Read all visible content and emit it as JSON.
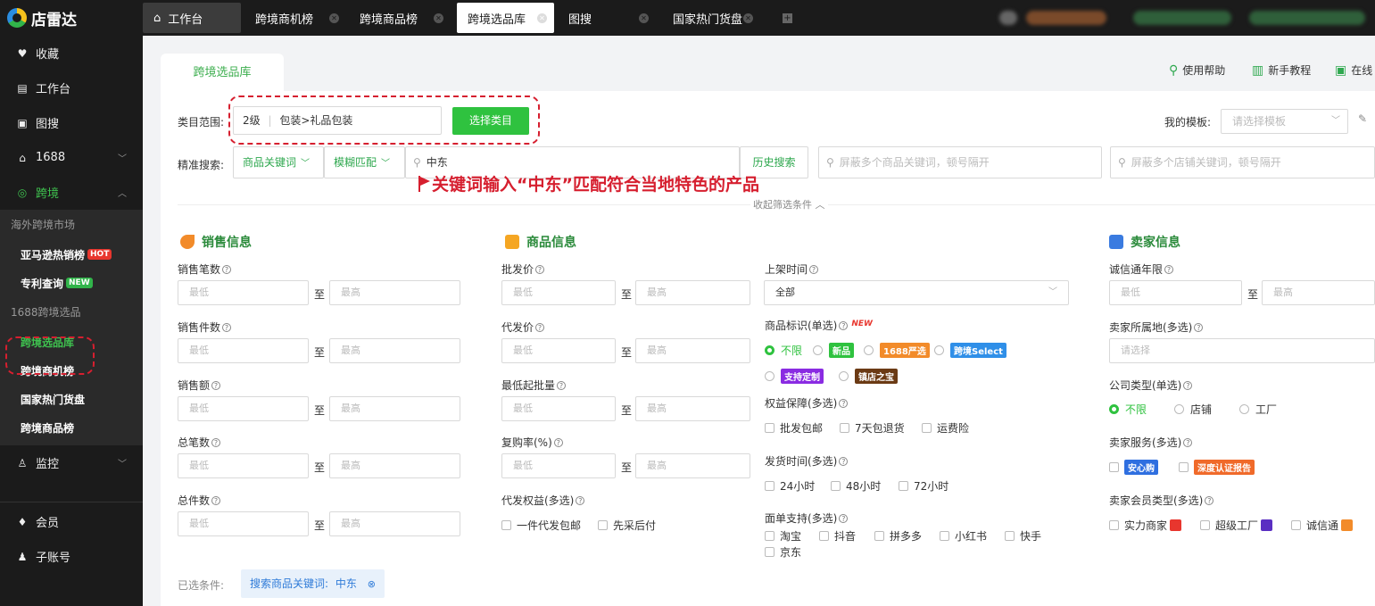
{
  "app": {
    "name": "店雷达"
  },
  "sidebar": {
    "top_items": [
      {
        "label": "收藏",
        "icon": "heart-icon"
      },
      {
        "label": "工作台",
        "icon": "desk-icon"
      },
      {
        "label": "图搜",
        "icon": "image-icon"
      },
      {
        "label": "1688",
        "icon": "shop-icon"
      },
      {
        "label": "跨境",
        "icon": "globe-icon"
      }
    ],
    "group1": "海外跨境市场",
    "sub1": [
      {
        "label": "亚马逊热销榜",
        "badge": "HOT"
      },
      {
        "label": "专利查询",
        "badge": "NEW"
      }
    ],
    "group2": "1688跨境选品",
    "sub2": [
      {
        "label": "跨境选品库"
      },
      {
        "label": "跨境商机榜"
      },
      {
        "label": "国家热门货盘"
      },
      {
        "label": "跨境商品榜"
      }
    ],
    "monitor": "监控",
    "bottom_items": [
      {
        "label": "会员"
      },
      {
        "label": "子账号"
      }
    ]
  },
  "tabs": [
    {
      "label": "工作台"
    },
    {
      "label": "跨境商机榜"
    },
    {
      "label": "跨境商品榜"
    },
    {
      "label": "跨境选品库"
    },
    {
      "label": "图搜"
    },
    {
      "label": "国家热门货盘"
    }
  ],
  "page": {
    "tab_title": "跨境选品库",
    "help": [
      "使用帮助",
      "新手教程",
      "在线"
    ],
    "category_label": "类目范围:",
    "category_level": "2级",
    "category_path": "包装>礼品包装",
    "choose_category": "选择类目",
    "template_label": "我的模板:",
    "template_placeholder": "请选择模板",
    "precise_label": "精准搜索:",
    "keyword_type": "商品关键词",
    "match_type": "模糊匹配",
    "keyword_value": "中东",
    "history": "历史搜索",
    "block_goods_placeholder": "屏蔽多个商品关键词，顿号隔开",
    "block_shop_placeholder": "屏蔽多个店铺关键词，顿号隔开",
    "collapse": "收起筛选条件",
    "annotation": "关键词输入“中东”匹配符合当地特色的产品"
  },
  "sales": {
    "title": "销售信息",
    "fields": [
      "销售笔数",
      "销售件数",
      "销售额",
      "总笔数",
      "总件数"
    ],
    "min": "最低",
    "max": "最高",
    "to": "至"
  },
  "goods": {
    "title": "商品信息",
    "fields": [
      "批发价",
      "代发价",
      "最低起批量",
      "复购率(%)"
    ],
    "daifa_title": "代发权益(多选)",
    "daifa_options": [
      "一件代发包邮",
      "先采后付"
    ],
    "shelf_time_label": "上架时间",
    "shelf_time_value": "全部",
    "mark_label": "商品标识(单选)",
    "mark_new": "NEW",
    "mark_options": [
      "不限",
      "新品",
      "1688严选",
      "跨境Select",
      "支持定制",
      "镇店之宝"
    ],
    "rights_label": "权益保障(多选)",
    "rights_options": [
      "批发包邮",
      "7天包退货",
      "运费险"
    ],
    "ship_label": "发货时间(多选)",
    "ship_options": [
      "24小时",
      "48小时",
      "72小时"
    ],
    "waybill_label": "面单支持(多选)",
    "waybill_options": [
      "淘宝",
      "抖音",
      "拼多多",
      "小红书",
      "快手",
      "京东"
    ]
  },
  "seller": {
    "title": "卖家信息",
    "years_label": "诚信通年限",
    "location_label": "卖家所属地(多选)",
    "location_placeholder": "请选择",
    "company_label": "公司类型(单选)",
    "company_options": [
      "不限",
      "店铺",
      "工厂"
    ],
    "service_label": "卖家服务(多选)",
    "service_options": [
      "安心购",
      "深度认证报告"
    ],
    "member_label": "卖家会员类型(多选)",
    "member_options": [
      "实力商家",
      "超级工厂",
      "诚信通"
    ]
  },
  "selected": {
    "label": "已选条件:",
    "chip_key": "搜索商品关键词:",
    "chip_value": "中东"
  }
}
